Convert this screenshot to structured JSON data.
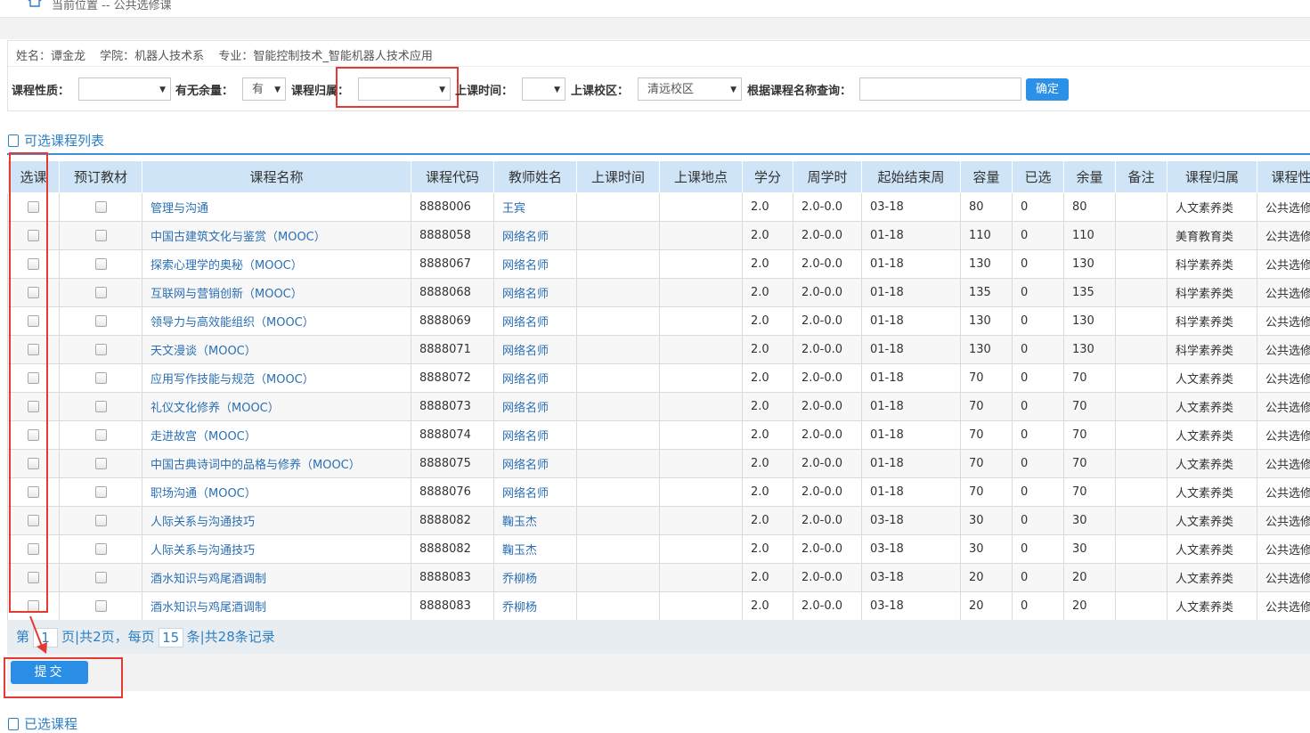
{
  "breadcrumb": "当前位置 -- 公共选修课",
  "student": {
    "name": "姓名：谭金龙",
    "college": "学院：机器人技术系",
    "major": "专业：智能控制技术_智能机器人技术应用"
  },
  "filters": {
    "nature_label": "课程性质：",
    "nature_value": "",
    "remain_label": "有无余量：",
    "remain_value": "有",
    "belong_label": "课程归属：",
    "belong_value": "",
    "time_label": "上课时间：",
    "time_value": "",
    "campus_label": "上课校区：",
    "campus_value": "清远校区",
    "search_label": "根据课程名称查询：",
    "search_value": "",
    "confirm_label": "确定"
  },
  "list_title": "可选课程列表",
  "columns": [
    "选课",
    "预订教材",
    "课程名称",
    "课程代码",
    "教师姓名",
    "上课时间",
    "上课地点",
    "学分",
    "周学时",
    "起始结束周",
    "容量",
    "已选",
    "余量",
    "备注",
    "课程归属",
    "课程性"
  ],
  "rows": [
    {
      "name": "管理与沟通",
      "code": "8888006",
      "teacher": "王宾",
      "time": "",
      "place": "",
      "credit": "2.0",
      "hours": "2.0-0.0",
      "weeks": "03-18",
      "cap": "80",
      "chosen": "0",
      "remain": "80",
      "note": "",
      "belong": "人文素养类",
      "nature": "公共选修"
    },
    {
      "name": "中国古建筑文化与鉴赏（MOOC）",
      "code": "8888058",
      "teacher": "网络名师",
      "time": "",
      "place": "",
      "credit": "2.0",
      "hours": "2.0-0.0",
      "weeks": "01-18",
      "cap": "110",
      "chosen": "0",
      "remain": "110",
      "note": "",
      "belong": "美育教育类",
      "nature": "公共选修"
    },
    {
      "name": "探索心理学的奥秘（MOOC）",
      "code": "8888067",
      "teacher": "网络名师",
      "time": "",
      "place": "",
      "credit": "2.0",
      "hours": "2.0-0.0",
      "weeks": "01-18",
      "cap": "130",
      "chosen": "0",
      "remain": "130",
      "note": "",
      "belong": "科学素养类",
      "nature": "公共选修"
    },
    {
      "name": "互联网与营销创新（MOOC）",
      "code": "8888068",
      "teacher": "网络名师",
      "time": "",
      "place": "",
      "credit": "2.0",
      "hours": "2.0-0.0",
      "weeks": "01-18",
      "cap": "135",
      "chosen": "0",
      "remain": "135",
      "note": "",
      "belong": "科学素养类",
      "nature": "公共选修"
    },
    {
      "name": "领导力与高效能组织（MOOC）",
      "code": "8888069",
      "teacher": "网络名师",
      "time": "",
      "place": "",
      "credit": "2.0",
      "hours": "2.0-0.0",
      "weeks": "01-18",
      "cap": "130",
      "chosen": "0",
      "remain": "130",
      "note": "",
      "belong": "科学素养类",
      "nature": "公共选修"
    },
    {
      "name": "天文漫谈（MOOC）",
      "code": "8888071",
      "teacher": "网络名师",
      "time": "",
      "place": "",
      "credit": "2.0",
      "hours": "2.0-0.0",
      "weeks": "01-18",
      "cap": "130",
      "chosen": "0",
      "remain": "130",
      "note": "",
      "belong": "科学素养类",
      "nature": "公共选修"
    },
    {
      "name": "应用写作技能与规范（MOOC）",
      "code": "8888072",
      "teacher": "网络名师",
      "time": "",
      "place": "",
      "credit": "2.0",
      "hours": "2.0-0.0",
      "weeks": "01-18",
      "cap": "70",
      "chosen": "0",
      "remain": "70",
      "note": "",
      "belong": "人文素养类",
      "nature": "公共选修"
    },
    {
      "name": "礼仪文化修养（MOOC）",
      "code": "8888073",
      "teacher": "网络名师",
      "time": "",
      "place": "",
      "credit": "2.0",
      "hours": "2.0-0.0",
      "weeks": "01-18",
      "cap": "70",
      "chosen": "0",
      "remain": "70",
      "note": "",
      "belong": "人文素养类",
      "nature": "公共选修"
    },
    {
      "name": "走进故宫（MOOC）",
      "code": "8888074",
      "teacher": "网络名师",
      "time": "",
      "place": "",
      "credit": "2.0",
      "hours": "2.0-0.0",
      "weeks": "01-18",
      "cap": "70",
      "chosen": "0",
      "remain": "70",
      "note": "",
      "belong": "人文素养类",
      "nature": "公共选修"
    },
    {
      "name": "中国古典诗词中的品格与修养（MOOC）",
      "code": "8888075",
      "teacher": "网络名师",
      "time": "",
      "place": "",
      "credit": "2.0",
      "hours": "2.0-0.0",
      "weeks": "01-18",
      "cap": "70",
      "chosen": "0",
      "remain": "70",
      "note": "",
      "belong": "人文素养类",
      "nature": "公共选修"
    },
    {
      "name": "职场沟通（MOOC）",
      "code": "8888076",
      "teacher": "网络名师",
      "time": "",
      "place": "",
      "credit": "2.0",
      "hours": "2.0-0.0",
      "weeks": "01-18",
      "cap": "70",
      "chosen": "0",
      "remain": "70",
      "note": "",
      "belong": "人文素养类",
      "nature": "公共选修"
    },
    {
      "name": "人际关系与沟通技巧",
      "code": "8888082",
      "teacher": "鞠玉杰",
      "time": "",
      "place": "",
      "credit": "2.0",
      "hours": "2.0-0.0",
      "weeks": "03-18",
      "cap": "30",
      "chosen": "0",
      "remain": "30",
      "note": "",
      "belong": "人文素养类",
      "nature": "公共选修"
    },
    {
      "name": "人际关系与沟通技巧",
      "code": "8888082",
      "teacher": "鞠玉杰",
      "time": "",
      "place": "",
      "credit": "2.0",
      "hours": "2.0-0.0",
      "weeks": "03-18",
      "cap": "30",
      "chosen": "0",
      "remain": "30",
      "note": "",
      "belong": "人文素养类",
      "nature": "公共选修"
    },
    {
      "name": "酒水知识与鸡尾酒调制",
      "code": "8888083",
      "teacher": "乔柳杨",
      "time": "",
      "place": "",
      "credit": "2.0",
      "hours": "2.0-0.0",
      "weeks": "03-18",
      "cap": "20",
      "chosen": "0",
      "remain": "20",
      "note": "",
      "belong": "人文素养类",
      "nature": "公共选修"
    },
    {
      "name": "酒水知识与鸡尾酒调制",
      "code": "8888083",
      "teacher": "乔柳杨",
      "time": "",
      "place": "",
      "credit": "2.0",
      "hours": "2.0-0.0",
      "weeks": "03-18",
      "cap": "20",
      "chosen": "0",
      "remain": "20",
      "note": "",
      "belong": "人文素养类",
      "nature": "公共选修"
    }
  ],
  "pager": {
    "prefix": "第",
    "page": "1",
    "middle": "页|共2页，每页",
    "per_page": "15",
    "suffix": "条|共28条记录"
  },
  "submit_label": "提交",
  "selected_title": "已选课程",
  "colors": {
    "accent": "#2b90e8",
    "header_bg": "#cfe5f7",
    "highlight": "#e53935",
    "link": "#2a6fb5"
  }
}
